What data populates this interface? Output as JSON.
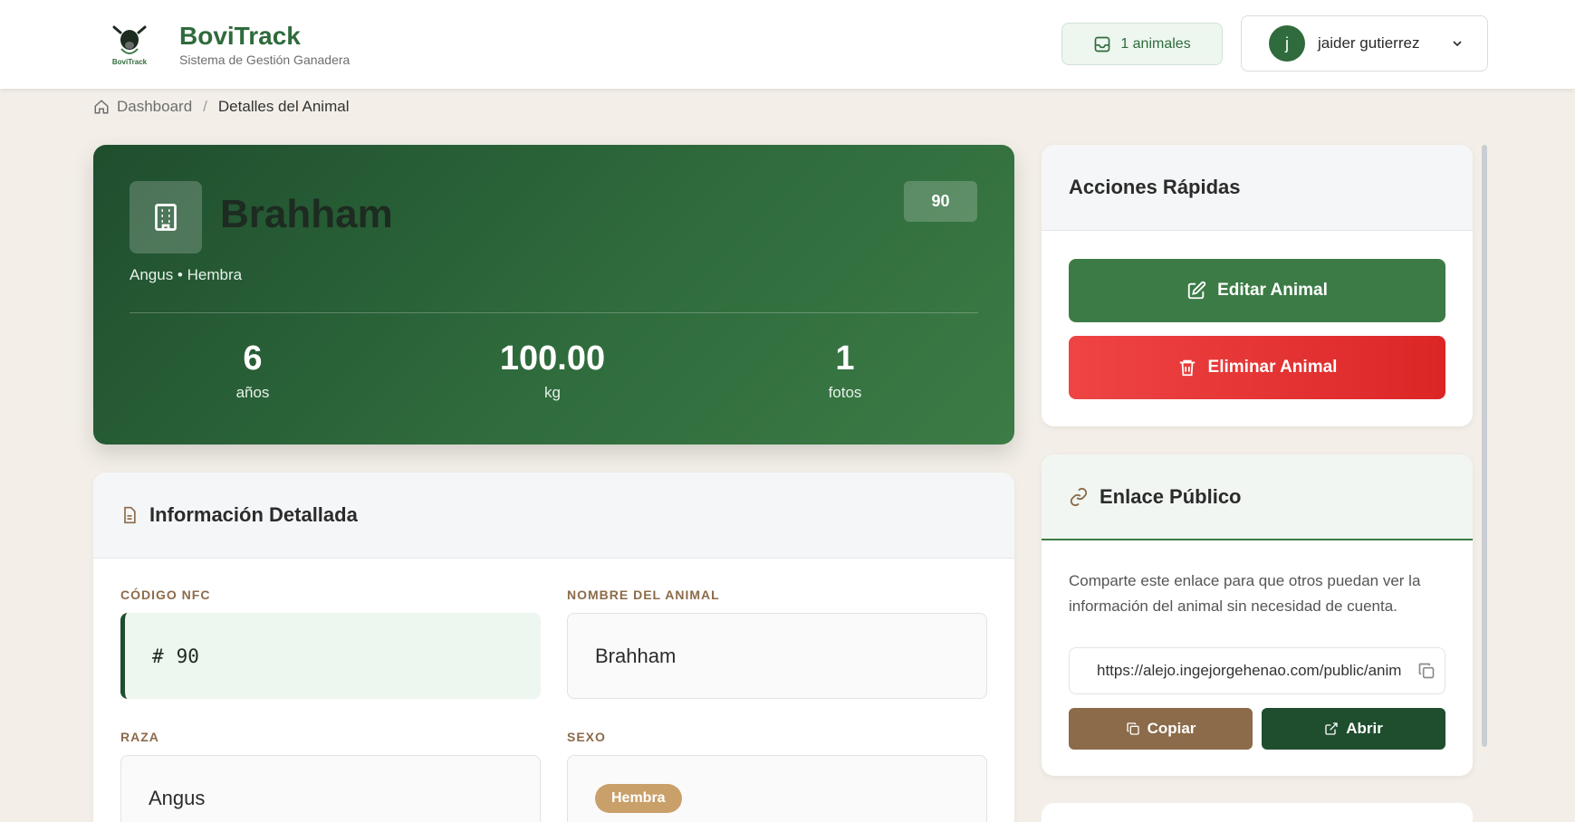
{
  "header": {
    "logo_text": "BoviTrack",
    "brand_name": "BoviTrack",
    "brand_subtitle": "Sistema de Gestión Ganadera",
    "count_pill": "1 animales",
    "user_initial": "j",
    "user_name": "jaider gutierrez"
  },
  "breadcrumb": {
    "home": "Dashboard",
    "separator": "/",
    "current": "Detalles del Animal"
  },
  "hero": {
    "name": "Brahham",
    "badge": "90",
    "subtitle": "Angus • Hembra",
    "stats": [
      {
        "value": "6",
        "label": "años"
      },
      {
        "value": "100.00",
        "label": "kg"
      },
      {
        "value": "1",
        "label": "fotos"
      }
    ]
  },
  "info": {
    "title": "Información Detallada",
    "fields": {
      "nfc_label": "CÓDIGO NFC",
      "nfc_value": "90",
      "nfc_symbol": "#",
      "name_label": "NOMBRE DEL ANIMAL",
      "name_value": "Brahham",
      "breed_label": "RAZA",
      "breed_value": "Angus",
      "sex_label": "SEXO",
      "sex_value": "Hembra"
    }
  },
  "quick_actions": {
    "title": "Acciones Rápidas",
    "edit_label": "Editar Animal",
    "delete_label": "Eliminar Animal"
  },
  "public_link": {
    "title": "Enlace Público",
    "description": "Comparte este enlace para que otros puedan ver la información del animal sin necesidad de cuenta.",
    "url": "https://alejo.ingejorgehenao.com/public/animal",
    "copy_label": "Copiar",
    "open_label": "Abrir"
  },
  "colors": {
    "brand_green": "#2f6b3c",
    "dark_green": "#1f4e2e",
    "brown": "#8b6b4a",
    "danger_red": "#ef4444",
    "background": "#f3efe8"
  }
}
